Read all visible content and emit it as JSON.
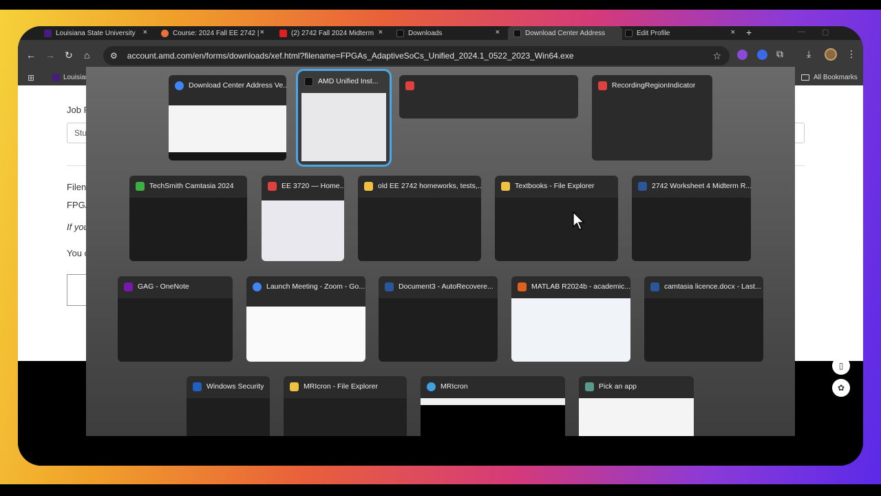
{
  "browser": {
    "tabs": [
      {
        "title": "Louisiana State University",
        "favicon_color": "#461d7c",
        "close": "×"
      },
      {
        "title": "Course: 2024 Fall EE 2742 |",
        "favicon_color": "#e8703a",
        "close": "×"
      },
      {
        "title": "(2) 2742 Fall 2024 Midterm",
        "favicon_color": "#e02020",
        "close": "×"
      },
      {
        "title": "Downloads",
        "favicon_color": "#1a1a1a",
        "close": "×"
      },
      {
        "title": "Download Center Address",
        "favicon_color": "#1a1a1a",
        "close": "×"
      },
      {
        "title": "Edit Profile",
        "favicon_color": "#1a1a1a",
        "close": "×"
      }
    ],
    "new_tab": "+",
    "url": "account.amd.com/en/forms/downloads/xef.html?filename=FPGAs_AdaptiveSoCs_Unified_2024.1_0522_2023_Win64.exe",
    "bookmark": "Louisiana",
    "all_bookmarks": "All Bookmarks"
  },
  "page": {
    "job_label": "Job F",
    "select_value": "Stu",
    "file_label": "Filen",
    "file_value": "FPGA",
    "note": "If you",
    "you_text": "You c"
  },
  "switcher": {
    "rows": [
      [
        {
          "title": "Download Center Address Ve...",
          "icon_color": "#4285f4",
          "thumb": "light"
        },
        {
          "title": "AMD Unified Inst...",
          "icon_color": "#1a1a1a",
          "thumb": "white",
          "selected": true
        },
        {
          "title": "",
          "icon_color": "#e04040",
          "thumb": "none"
        },
        {
          "title": "RecordingRegionIndicator",
          "icon_color": "#e04040",
          "thumb": "dark"
        }
      ],
      [
        {
          "title": "TechSmith Camtasia 2024",
          "icon_color": "#3cb043",
          "thumb": "editor"
        },
        {
          "title": "EE 3720 — Home...",
          "icon_color": "#e04040",
          "thumb": "pdf"
        },
        {
          "title": "old EE 2742 homeworks, tests,...",
          "icon_color": "#f0c040",
          "thumb": "explorer"
        },
        {
          "title": "Textbooks - File Explorer",
          "icon_color": "#f0c040",
          "thumb": "explorer"
        },
        {
          "title": "2742 Worksheet 4 Midterm R...",
          "icon_color": "#2b579a",
          "thumb": "word"
        }
      ],
      [
        {
          "title": "GAG - OneNote",
          "icon_color": "#7719aa",
          "thumb": "dark"
        },
        {
          "title": "Launch Meeting - Zoom - Go...",
          "icon_color": "#4285f4",
          "thumb": "white"
        },
        {
          "title": "Document3  -  AutoRecovere...",
          "icon_color": "#2b579a",
          "thumb": "word"
        },
        {
          "title": "MATLAB R2024b - academic...",
          "icon_color": "#e06020",
          "thumb": "matlab"
        },
        {
          "title": "camtasia licence.docx  -  Last...",
          "icon_color": "#2b579a",
          "thumb": "word"
        }
      ],
      [
        {
          "title": "Windows Security",
          "icon_color": "#2060c0",
          "thumb": "dark"
        },
        {
          "title": "MRIcron - File Explorer",
          "icon_color": "#f0c040",
          "thumb": "explorer"
        },
        {
          "title": "MRIcron",
          "icon_color": "#40a0e0",
          "thumb": "mri"
        },
        {
          "title": "Pick an app",
          "icon_color": "#5a9a8a",
          "thumb": "white"
        }
      ]
    ]
  },
  "colors": {
    "selected_outline": "#4aa8e8",
    "overlay": "#5a5a5a",
    "tab_bar": "#1f1f1f"
  }
}
